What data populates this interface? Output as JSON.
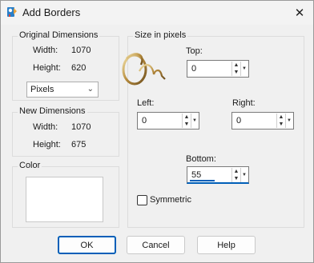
{
  "window": {
    "title": "Add Borders",
    "close_glyph": "✕"
  },
  "original": {
    "group_title": "Original Dimensions",
    "width_label": "Width:",
    "width_value": "1070",
    "height_label": "Height:",
    "height_value": "620",
    "unit_selected": "Pixels"
  },
  "new_dims": {
    "group_title": "New Dimensions",
    "width_label": "Width:",
    "width_value": "1070",
    "height_label": "Height:",
    "height_value": "675"
  },
  "color": {
    "group_title": "Color",
    "swatch": "#ffffff"
  },
  "size": {
    "group_title": "Size in pixels",
    "top_label": "Top:",
    "top_value": "0",
    "left_label": "Left:",
    "left_value": "0",
    "right_label": "Right:",
    "right_value": "0",
    "bottom_label": "Bottom:",
    "bottom_value": "55",
    "bottom_slider_fraction": 0.55,
    "symmetric_label": "Symmetric",
    "symmetric_checked": false
  },
  "buttons": {
    "ok": "OK",
    "cancel": "Cancel",
    "help": "Help"
  },
  "accent_color": "#005fb8"
}
